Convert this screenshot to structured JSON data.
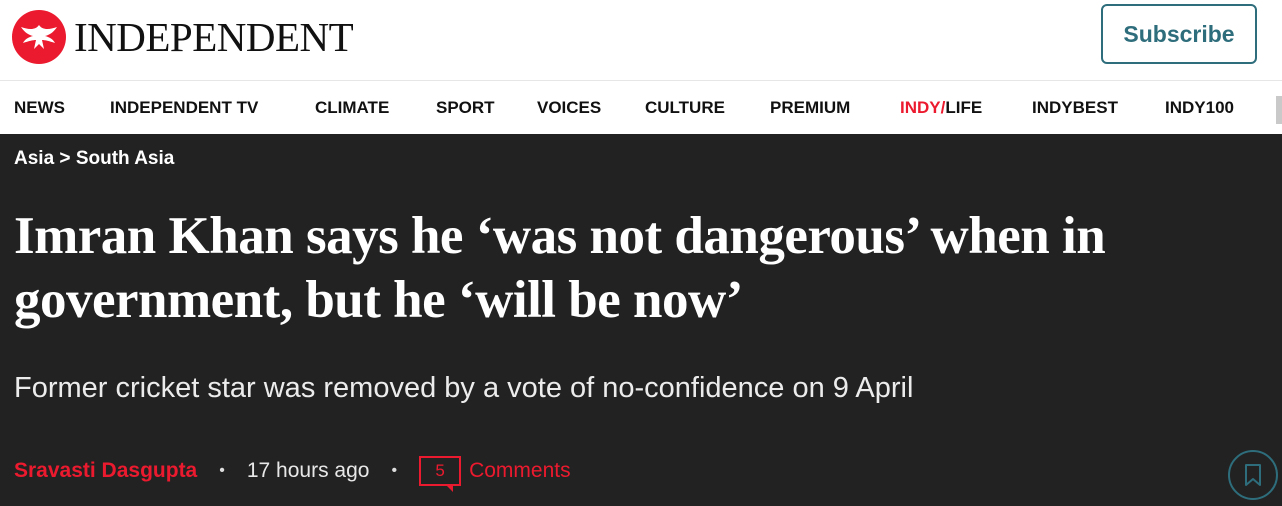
{
  "masthead": {
    "logo_text": "INDEPENDENT",
    "logo_icon": "eagle-icon",
    "subscribe_label": "Subscribe"
  },
  "nav": {
    "items": [
      {
        "label": "NEWS"
      },
      {
        "label": "INDEPENDENT TV"
      },
      {
        "label": "CLIMATE"
      },
      {
        "label": "SPORT"
      },
      {
        "label": "VOICES"
      },
      {
        "label": "CULTURE"
      },
      {
        "label": "PREMIUM"
      },
      {
        "label_red": "INDY/",
        "label_rest": "LIFE"
      },
      {
        "label": "INDYBEST"
      },
      {
        "label": "INDY100"
      }
    ]
  },
  "article": {
    "breadcrumb": {
      "parent": "Asia",
      "separator": ">",
      "current": "South Asia"
    },
    "headline": "Imran Khan says he ‘was not dangerous’ when in government, but he ‘will be now’",
    "standfirst": "Former cricket star was removed by a vote of no-confidence on 9 April",
    "author": "Sravasti Dasgupta",
    "bullet": "•",
    "time": "17 hours ago",
    "comments_count": "5",
    "comments_label": "Comments",
    "comment_icon": "comment-bubble-icon",
    "bookmark_icon": "bookmark-icon"
  },
  "colors": {
    "brand_red": "#ec1a2e",
    "accent_teal": "#2e6d7b",
    "article_bg": "#222222"
  }
}
